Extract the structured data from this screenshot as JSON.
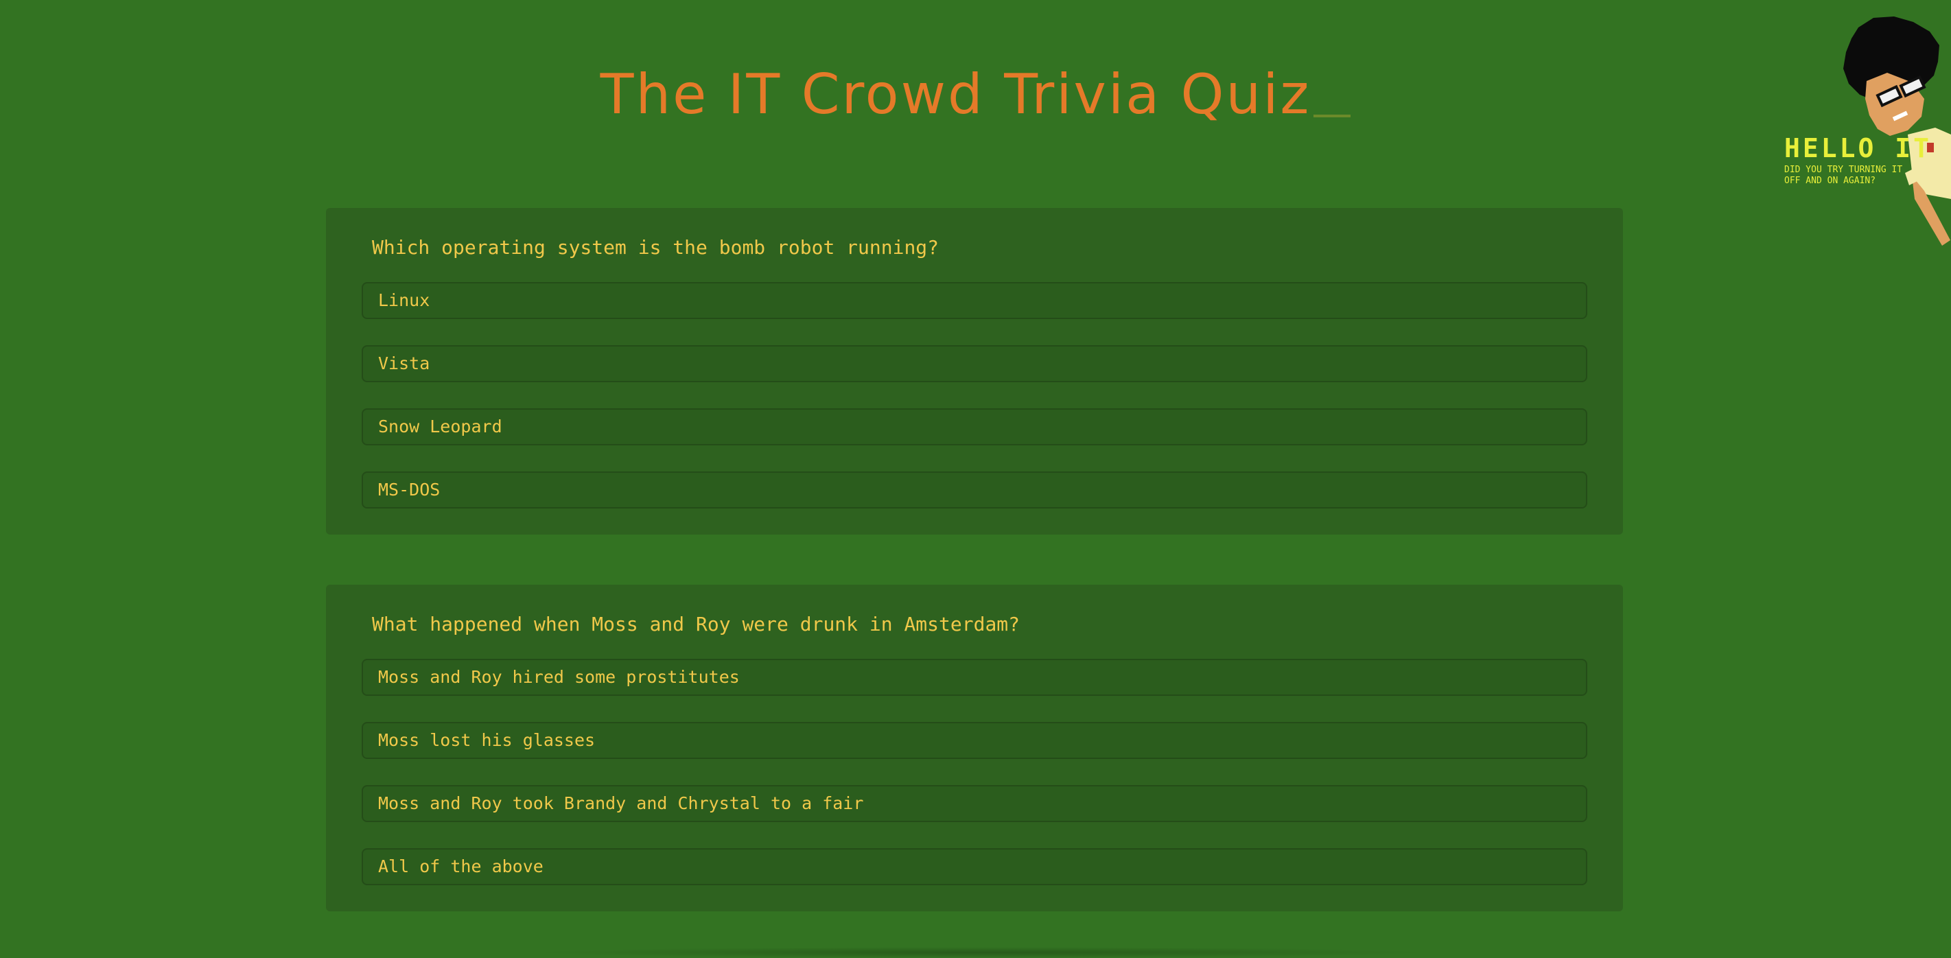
{
  "page": {
    "title": "The IT Crowd Trivia Quiz"
  },
  "questions": [
    {
      "text": "Which operating system is the bomb robot running?",
      "options": [
        "Linux",
        "Vista",
        "Snow Leopard",
        "MS-DOS"
      ]
    },
    {
      "text": "What happened when Moss and Roy were drunk in Amsterdam?",
      "options": [
        "Moss and Roy hired some prostitutes",
        "Moss lost his glasses",
        "Moss and Roy took Brandy and Chrystal to a fair",
        "All of the above"
      ]
    }
  ],
  "mascot": {
    "headline": "HELLO IT",
    "subline": "DID YOU TRY TURNING IT OFF AND ON AGAIN?"
  },
  "colors": {
    "background": "#337322",
    "card": "#2e621f",
    "title": "#e57a29",
    "text": "#f0c84a",
    "mascot_text": "#e8ef3a"
  }
}
